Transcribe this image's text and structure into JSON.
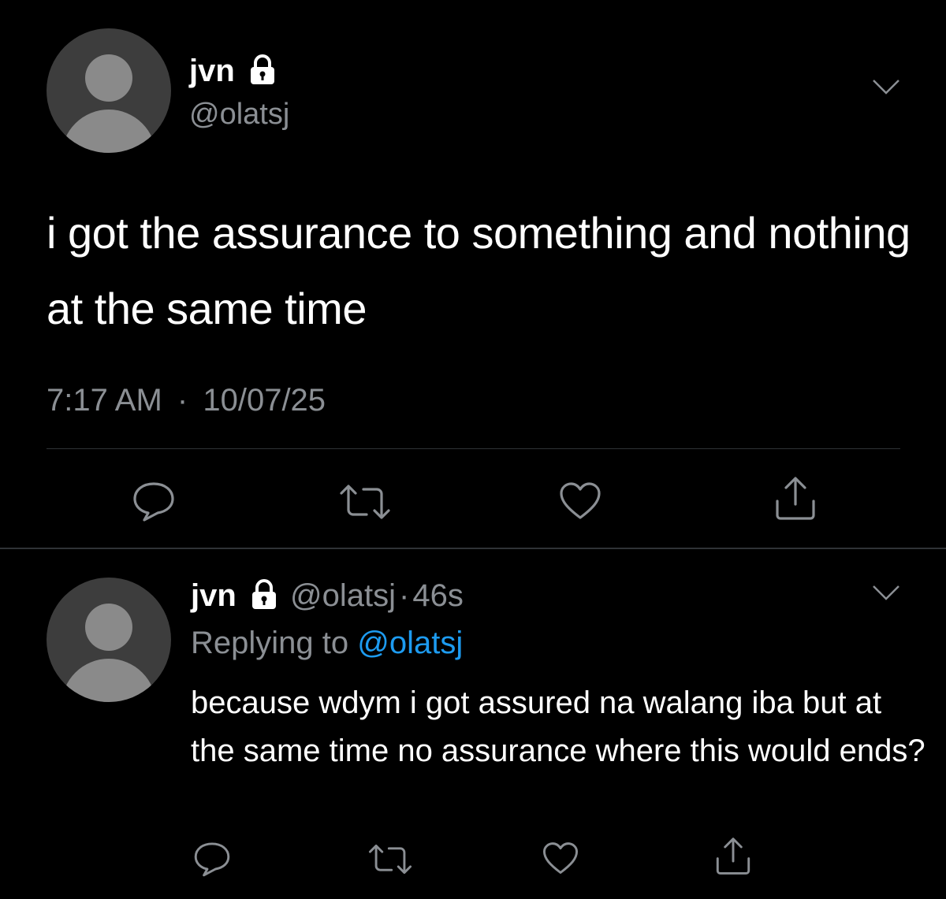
{
  "tweet": {
    "display_name": "jvn",
    "handle": "@olatsj",
    "text": "i got the assurance to something and nothing at the same time",
    "time": "7:17 AM",
    "separator": "·",
    "date": "10/07/25",
    "actions": [
      "reply-icon",
      "retweet-icon",
      "like-icon",
      "share-icon"
    ]
  },
  "reply": {
    "display_name": "jvn",
    "handle": "@olatsj",
    "separator": "·",
    "age": "46s",
    "replying_prefix": "Replying to ",
    "replying_to": "@olatsj",
    "text": "because wdym i got assured na walang iba but at the same time no assurance where this would ends?",
    "actions": [
      "reply-icon",
      "retweet-icon",
      "like-icon",
      "share-icon"
    ]
  },
  "colors": {
    "background": "#000000",
    "text": "#ffffff",
    "secondary": "#8b8f94",
    "link": "#1d9bf0",
    "divider": "#2f3336",
    "icon": "#8b8f94"
  },
  "icons": {
    "lock": "lock-icon",
    "chevron": "chevron-down-icon",
    "avatar": "default-avatar-icon"
  }
}
